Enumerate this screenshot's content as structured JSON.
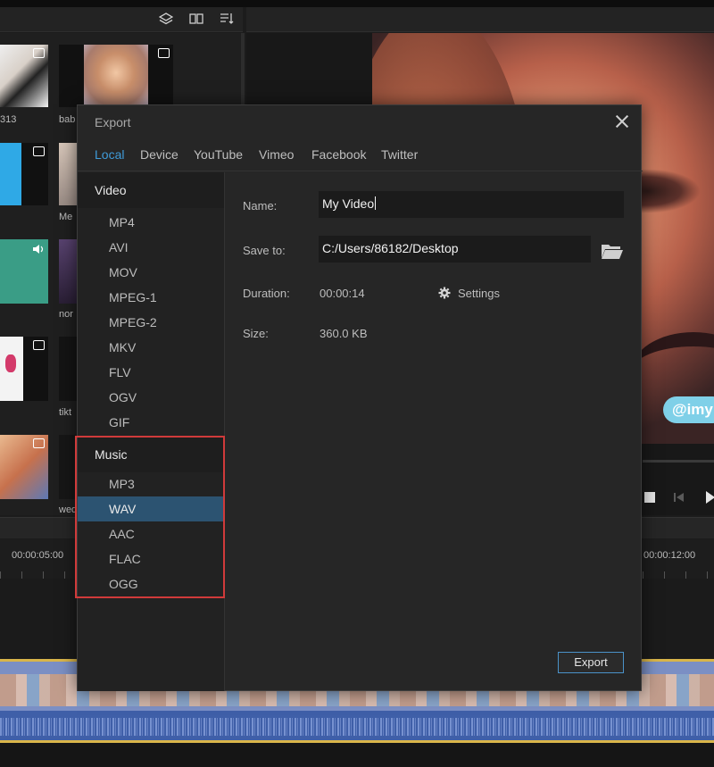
{
  "library": {
    "thumbs": [
      {
        "label": "313"
      },
      {
        "label": "bab"
      },
      {
        "label": "Me"
      },
      {
        "label": "nor"
      },
      {
        "label": "tikt"
      },
      {
        "label": "wed"
      }
    ]
  },
  "preview": {
    "watermark": "@imy"
  },
  "timeline": {
    "left_time": "00:00:05:00",
    "right_time": "00:00:12:00"
  },
  "dialog": {
    "title": "Export",
    "tabs": [
      "Local",
      "Device",
      "YouTube",
      "Vimeo",
      "Facebook",
      "Twitter"
    ],
    "active_tab": "Local",
    "video_heading": "Video",
    "video_formats": [
      "MP4",
      "AVI",
      "MOV",
      "MPEG-1",
      "MPEG-2",
      "MKV",
      "FLV",
      "OGV",
      "GIF"
    ],
    "music_heading": "Music",
    "music_formats": [
      "MP3",
      "WAV",
      "AAC",
      "FLAC",
      "OGG"
    ],
    "selected_format": "WAV",
    "name_label": "Name:",
    "name_value": "My Video",
    "save_label": "Save to:",
    "save_value": "C:/Users/86182/Desktop",
    "duration_label": "Duration:",
    "duration_value": "00:00:14",
    "settings_label": "Settings",
    "size_label": "Size:",
    "size_value": "360.0 KB",
    "export_label": "Export"
  },
  "colors": {
    "accent": "#3f9bd8",
    "selected_row": "#2c5371",
    "highlight_box": "#d03a3a"
  }
}
